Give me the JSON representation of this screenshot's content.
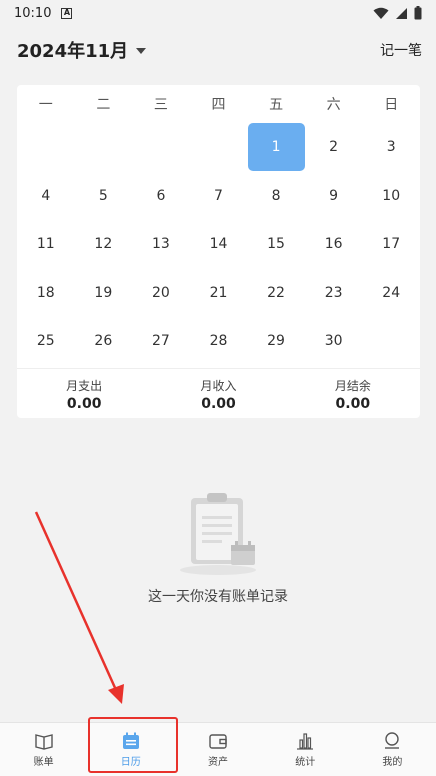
{
  "status_bar": {
    "time": "10:10",
    "notif_letter": "A",
    "icons": [
      "wifi-icon",
      "signal-icon",
      "battery-icon"
    ]
  },
  "header": {
    "title": "2024年11月",
    "add_label": "记一笔"
  },
  "calendar": {
    "weekdays": [
      "一",
      "二",
      "三",
      "四",
      "五",
      "六",
      "日"
    ],
    "leading_blanks": 4,
    "days": [
      "1",
      "2",
      "3",
      "4",
      "5",
      "6",
      "7",
      "8",
      "9",
      "10",
      "11",
      "12",
      "13",
      "14",
      "15",
      "16",
      "17",
      "18",
      "19",
      "20",
      "21",
      "22",
      "23",
      "24",
      "25",
      "26",
      "27",
      "28",
      "29",
      "30"
    ],
    "selected_day": "1",
    "accent_color": "#6aaef0"
  },
  "summary": {
    "expense_label": "月支出",
    "expense_value": "0.00",
    "income_label": "月收入",
    "income_value": "0.00",
    "balance_label": "月结余",
    "balance_value": "0.00"
  },
  "empty_state": {
    "message": "这一天你没有账单记录",
    "icon": "clipboard-calendar-icon"
  },
  "bottom_nav": {
    "items": [
      {
        "label": "账单",
        "icon": "book-icon"
      },
      {
        "label": "日历",
        "icon": "calendar-icon"
      },
      {
        "label": "资产",
        "icon": "wallet-icon"
      },
      {
        "label": "统计",
        "icon": "bar-chart-icon"
      },
      {
        "label": "我的",
        "icon": "profile-icon"
      }
    ],
    "active_index": 1,
    "active_color": "#4a9be8"
  },
  "annotation": {
    "color": "#e8322c"
  }
}
